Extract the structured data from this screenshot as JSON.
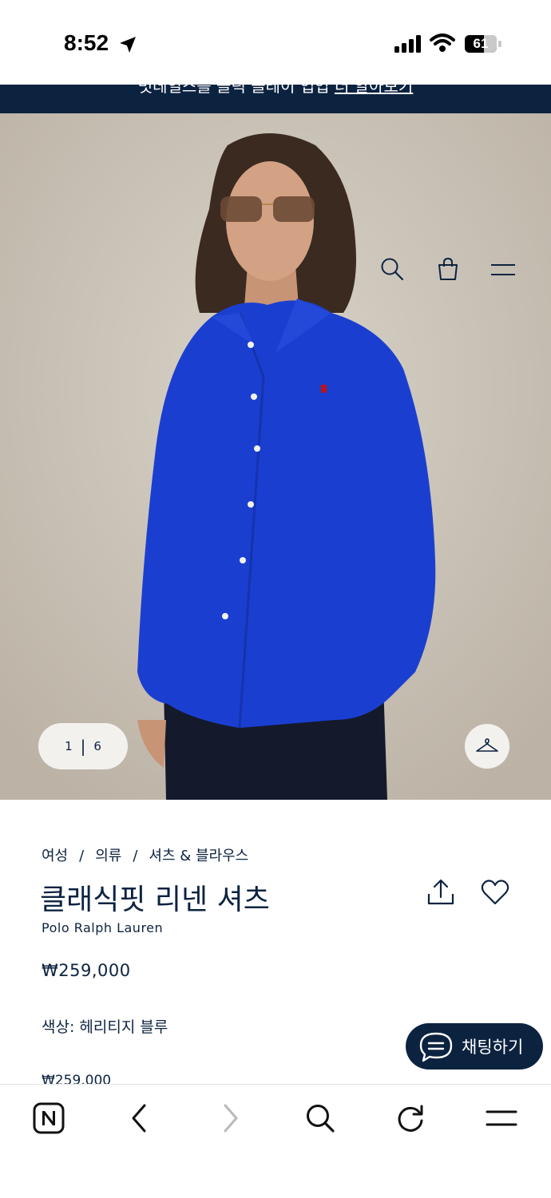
{
  "status_bar": {
    "time": "8:52",
    "battery": "61",
    "battery_level": 0.61
  },
  "banner": {
    "text": "멋데일스를 클릭 클레이 업업",
    "link": "더 알아보기"
  },
  "gallery": {
    "current": "1",
    "separator": "|",
    "total": "6"
  },
  "breadcrumb": [
    "여성",
    "의류",
    "셔츠 & 블라우스"
  ],
  "breadcrumb_separator": "/",
  "product": {
    "title": "클래식핏 리넨 셔츠",
    "brand": "Polo Ralph Lauren",
    "price": "₩259,000",
    "color_label": "색상: 헤리티지 블루",
    "partial_price": "₩259,000"
  },
  "chat": {
    "label": "채팅하기"
  },
  "colors": {
    "navy": "#0c2340",
    "shirt_blue": "#1a3fd0",
    "backdrop": "#cfc8bd"
  },
  "icons": {
    "header": [
      "search-icon",
      "shopping-bag-icon",
      "menu-icon"
    ],
    "product": [
      "share-icon",
      "heart-icon"
    ],
    "toolbar": [
      "naver-home-icon",
      "back-icon",
      "forward-icon",
      "search-icon",
      "reload-icon",
      "menu-icon"
    ]
  }
}
